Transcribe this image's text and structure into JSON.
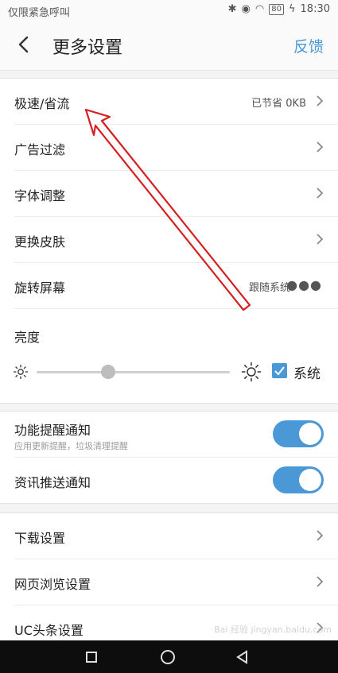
{
  "status_bar": {
    "carrier": "仅限紧急呼叫",
    "battery": "80",
    "time": "18:30"
  },
  "header": {
    "title": "更多设置",
    "feedback": "反馈"
  },
  "group1": [
    {
      "label": "极速/省流",
      "value": "已节省 0KB",
      "action": "chevron"
    },
    {
      "label": "广告过滤",
      "value": "",
      "action": "chevron"
    },
    {
      "label": "字体调整",
      "value": "",
      "action": "chevron"
    },
    {
      "label": "更换皮肤",
      "value": "",
      "action": "chevron"
    },
    {
      "label": "旋转屏幕",
      "value": "跟随系统",
      "action": "dots"
    }
  ],
  "brightness": {
    "label": "亮度",
    "level": 0.37,
    "system_label": "系统",
    "system_checked": true
  },
  "group2": [
    {
      "label": "功能提醒通知",
      "sub": "应用更新提醒，垃圾清理提醒",
      "on": true
    },
    {
      "label": "资讯推送通知",
      "sub": "",
      "on": true
    }
  ],
  "group3": [
    {
      "label": "下载设置"
    },
    {
      "label": "网页浏览设置"
    },
    {
      "label": "UC头条设置"
    }
  ],
  "watermark": "Bai 经验 jingyan.baidu.com",
  "colors": {
    "accent": "#4a98d5",
    "annotation": "#d42020"
  }
}
